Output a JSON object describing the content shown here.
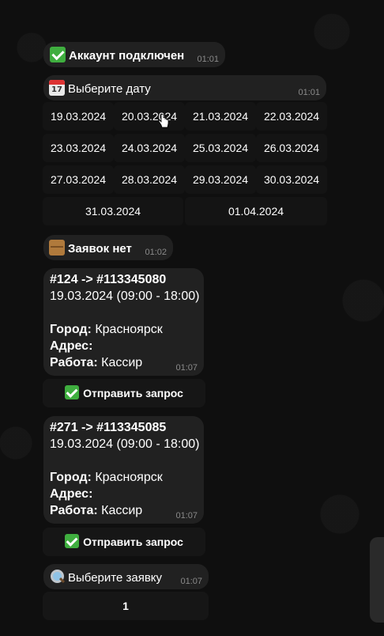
{
  "messages": {
    "account": {
      "text": "Аккаунт подключен",
      "time": "01:01"
    },
    "choose_date": {
      "text": "Выберите дату",
      "time": "01:01"
    },
    "no_orders": {
      "text": "Заявок нет",
      "time": "01:02"
    },
    "order1": {
      "header": "#124 -> #113345080",
      "date_line": "19.03.2024 (09:00 - 18:00)",
      "city_label": "Город:",
      "city_value": " Красноярск",
      "address_label": "Адрес:",
      "address_value": "",
      "work_label": "Работа:",
      "work_value": " Кассир",
      "time": "01:07",
      "button": "Отправить запрос"
    },
    "order2": {
      "header": "#271 -> #113345085",
      "date_line": "19.03.2024 (09:00 - 18:00)",
      "city_label": "Город:",
      "city_value": " Красноярск",
      "address_label": "Адрес:",
      "address_value": "",
      "work_label": "Работа:",
      "work_value": " Кассир",
      "time": "01:07",
      "button": "Отправить запрос"
    },
    "choose_order": {
      "text": "Выберите заявку",
      "time": "01:07"
    }
  },
  "dates": [
    "19.03.2024",
    "20.03.2024",
    "21.03.2024",
    "22.03.2024",
    "23.03.2024",
    "24.03.2024",
    "25.03.2024",
    "26.03.2024",
    "27.03.2024",
    "28.03.2024",
    "29.03.2024",
    "30.03.2024",
    "31.03.2024",
    "01.04.2024"
  ],
  "pagination": {
    "page": "1"
  },
  "icons": {
    "account": "check-mark-icon",
    "choose_date": "calendar-icon",
    "no_orders": "package-icon",
    "send": "check-mark-icon",
    "choose_order": "magnifier-icon"
  }
}
